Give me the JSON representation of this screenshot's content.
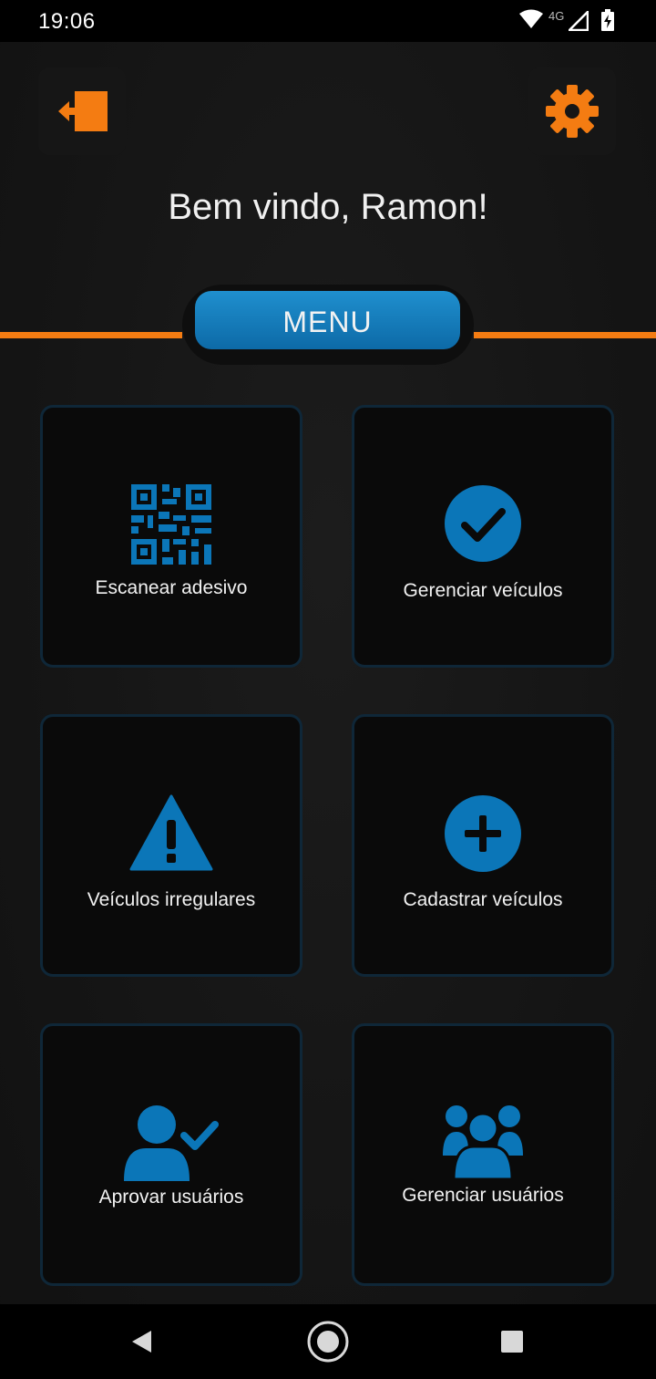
{
  "status_bar": {
    "time": "19:06",
    "network": "4G",
    "icons": [
      "wifi-icon",
      "cell-signal-icon",
      "battery-charging-icon"
    ]
  },
  "header": {
    "logout_icon": "logout-icon",
    "settings_icon": "gear-icon",
    "welcome": "Bem vindo, Ramon!"
  },
  "menu": {
    "label": "MENU"
  },
  "tiles": [
    {
      "label": "Escanear adesivo",
      "icon": "qr-code-icon"
    },
    {
      "label": "Gerenciar veículos",
      "icon": "check-circle-icon"
    },
    {
      "label": "Veículos irregulares",
      "icon": "warning-icon"
    },
    {
      "label": "Cadastrar veículos",
      "icon": "plus-circle-icon"
    },
    {
      "label": "Aprovar usuários",
      "icon": "user-check-icon"
    },
    {
      "label": "Gerenciar usuários",
      "icon": "users-group-icon"
    }
  ],
  "nav": {
    "icons": [
      "back-icon",
      "home-icon",
      "recents-icon"
    ]
  },
  "colors": {
    "accent_orange": "#f47c12",
    "accent_blue": "#0b76b8",
    "tile_bg": "#0a0a0a",
    "tile_border": "#0f2738"
  }
}
